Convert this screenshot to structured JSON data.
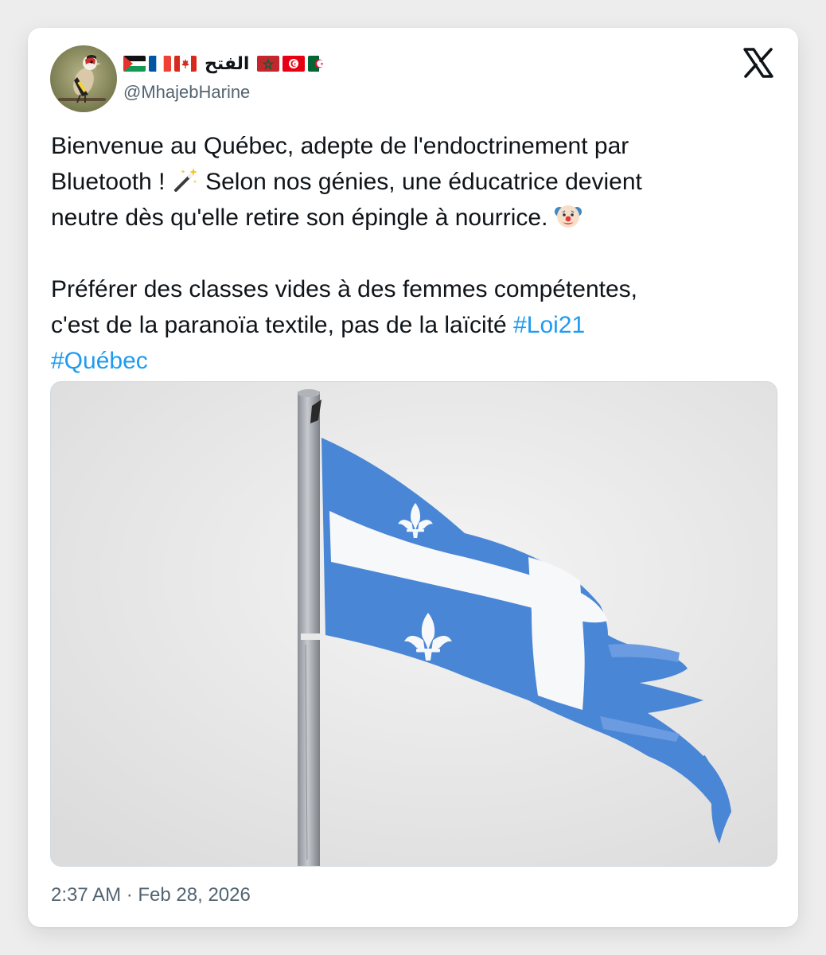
{
  "author": {
    "display_name": "الفتح",
    "handle": "@MhajebHarine",
    "flags_before": [
      "palestine-flag",
      "france-flag",
      "canada-flag"
    ],
    "flags_after": [
      "morocco-flag",
      "tunisia-flag",
      "algeria-flag"
    ]
  },
  "tweet": {
    "line1": "Bienvenue au Québec, adepte de l'endoctrinement par",
    "line2a": "Bluetooth ! ",
    "emoji1": "magic-wand-icon",
    "line2b": " Selon nos génies, une éducatrice devient",
    "line3": "neutre dès qu'elle retire son épingle à nourrice. ",
    "emoji2": "clown-face-icon",
    "line4": "Préférer des classes vides à des femmes compétentes,",
    "line5": "c'est de la paranoïa textile, pas de la laïcité ",
    "hashtag1": "#Loi21",
    "hashtag2": "#Québec"
  },
  "media": {
    "subject": "quebec-flag-on-pole"
  },
  "timestamp": "2:37 AM · Feb 28, 2026",
  "brand": {
    "logo": "x-logo-icon",
    "hashtag_color": "#1d9bf0",
    "text_color": "#0f1419",
    "muted_color": "#536471",
    "flag_blue": "#4a86d6"
  }
}
